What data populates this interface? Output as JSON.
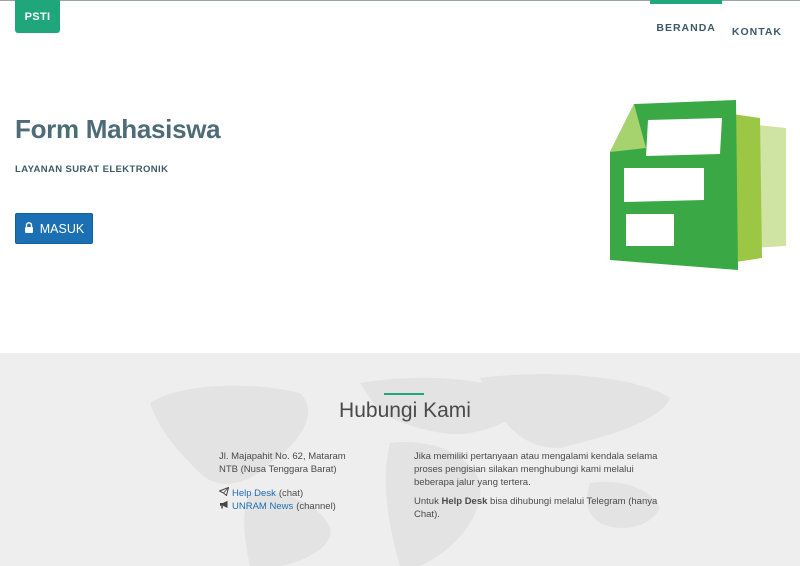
{
  "header": {
    "logo": "PSTI",
    "nav": [
      {
        "label": "BERANDA",
        "active": true
      },
      {
        "label": "KONTAK",
        "active": false
      }
    ],
    "accent_color": "#1fa67a"
  },
  "hero": {
    "title": "Form Mahasiswa",
    "subtitle": "LAYANAN SURAT ELEKTRONIK",
    "login_button": "MASUK",
    "login_icon": "lock-icon",
    "illustration_icon": "google-forms-icon"
  },
  "contact": {
    "title": "Hubungi Kami",
    "address_line1": "Jl. Majapahit No. 62, Mataram",
    "address_line2": "NTB (Nusa Tenggara Barat)",
    "links": [
      {
        "name": "Help Desk",
        "suffix": "(chat)",
        "icon": "telegram-icon"
      },
      {
        "name": "UNRAM News",
        "suffix": "(channel)",
        "icon": "megaphone-icon"
      }
    ],
    "note_paragraph": "Jika memiliki pertanyaan atau mengalami kendala selama proses pengisian silakan menghubungi kami melalui beberapa jalur yang tertera.",
    "helpdesk_prefix": "Untuk",
    "helpdesk_bold": "Help Desk",
    "helpdesk_rest": "bisa dihubungi melalui Telegram (hanya Chat)."
  }
}
